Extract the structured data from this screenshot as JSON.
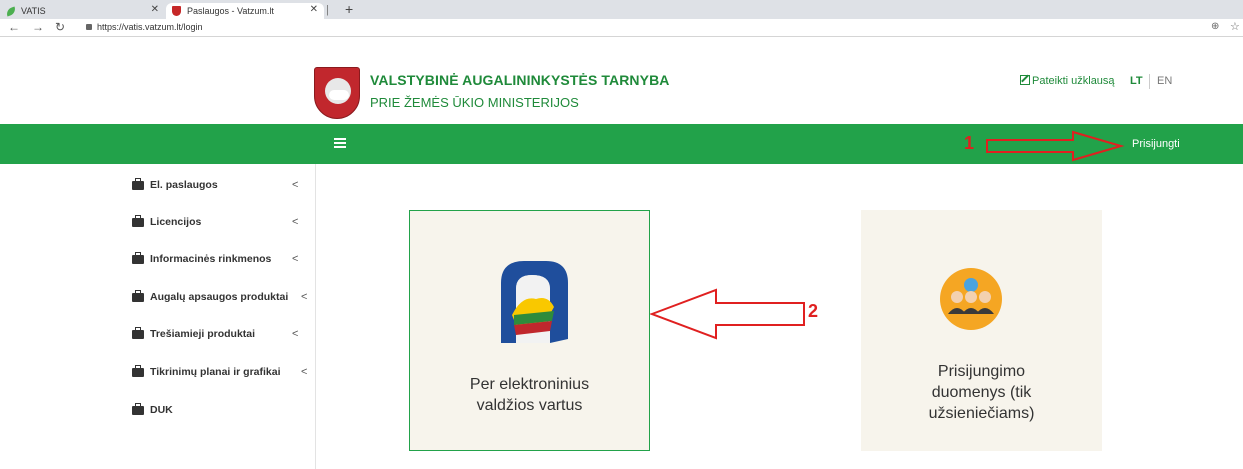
{
  "browser": {
    "tabs": [
      {
        "label": "VATIS",
        "active": false
      },
      {
        "label": "Paslaugos - Vatzum.lt",
        "active": true
      }
    ],
    "url": "https://vatis.vatzum.lt/login"
  },
  "header": {
    "org_title": "VALSTYBINĖ AUGALININKYSTĖS TARNYBA",
    "org_subtitle": "PRIE ŽEMĖS ŪKIO MINISTERIJOS",
    "query_link": "Pateikti užklausą",
    "lang_lt": "LT",
    "lang_en": "EN",
    "brand_color": "#22a24a"
  },
  "navbar": {
    "login_label": "Prisijungti"
  },
  "annotations": {
    "one": "1",
    "two": "2",
    "color": "#e02020"
  },
  "sidebar": {
    "items": [
      {
        "label": "El. paslaugos",
        "has_caret": true
      },
      {
        "label": "Licencijos",
        "has_caret": true
      },
      {
        "label": "Informacinės rinkmenos",
        "has_caret": true
      },
      {
        "label": "Augalų apsaugos produktai",
        "has_caret": true
      },
      {
        "label": "Trešiamieji produktai",
        "has_caret": true
      },
      {
        "label": "Tikrinimų planai ir grafikai",
        "has_caret": true
      },
      {
        "label": "DUK",
        "has_caret": false
      }
    ],
    "caret": "<"
  },
  "tiles": {
    "gateway": {
      "label": "Per elektroninius\nvaldžios vartus"
    },
    "credentials": {
      "label": "Prisijungimo\nduomenys (tik\nužsieniečiams)"
    }
  }
}
